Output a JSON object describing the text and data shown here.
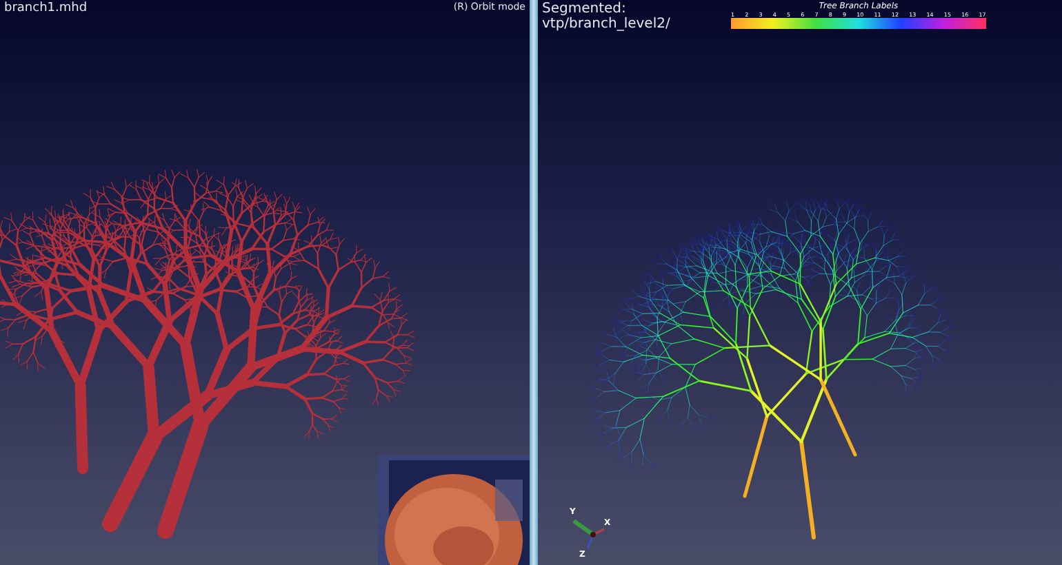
{
  "left_view": {
    "title": "branch1.mhd",
    "mode": "(R) Orbit mode"
  },
  "right_view": {
    "title": "Segmented: vtp/branch_level2/",
    "legend": {
      "title": "Tree Branch Labels",
      "ticks": [
        "1",
        "2",
        "3",
        "4",
        "5",
        "6",
        "7",
        "8",
        "9",
        "10",
        "11",
        "12",
        "13",
        "14",
        "15",
        "16",
        "17"
      ]
    },
    "axes": {
      "labels": [
        "Y",
        "X",
        "Z"
      ]
    }
  }
}
